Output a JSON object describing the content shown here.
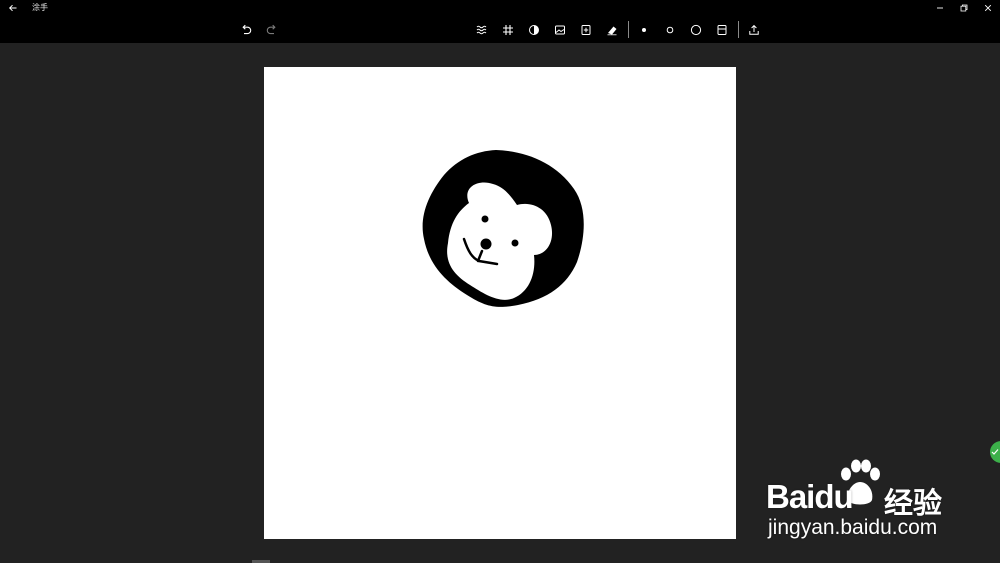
{
  "window": {
    "title": "涂手",
    "back_icon": "back-arrow-icon",
    "controls": [
      "minimize-icon",
      "restore-icon",
      "close-icon"
    ]
  },
  "toolbar": {
    "left_tools": [
      {
        "name": "undo-button",
        "icon": "undo-icon"
      },
      {
        "name": "redo-button",
        "icon": "redo-icon"
      }
    ],
    "center_tools": [
      {
        "name": "brush-texture-button",
        "icon": "waves-icon"
      },
      {
        "name": "grid-button",
        "icon": "grid-icon"
      },
      {
        "name": "contrast-button",
        "icon": "half-circle-icon"
      },
      {
        "name": "import-image-button",
        "icon": "image-icon"
      },
      {
        "name": "insert-button",
        "icon": "insert-icon"
      },
      {
        "name": "eraser-button",
        "icon": "eraser-icon"
      },
      {
        "name": "brush-size-small-button",
        "icon": "dot-small-icon"
      },
      {
        "name": "brush-size-medium-button",
        "icon": "circle-medium-icon"
      },
      {
        "name": "brush-size-large-button",
        "icon": "circle-large-icon"
      },
      {
        "name": "save-button",
        "icon": "save-icon"
      },
      {
        "name": "share-button",
        "icon": "share-icon"
      }
    ]
  },
  "canvas": {
    "background": "#ffffff",
    "drawing": "black-blob-with-white-bear-face"
  },
  "colors": {
    "app_background": "#222222",
    "bar_background": "#000000",
    "icon": "#ffffff",
    "badge": "#3cb04a"
  },
  "watermark": {
    "brand": "Bai",
    "brand_tail": "du",
    "cn": "经验",
    "url": "jingyan.baidu.com"
  }
}
